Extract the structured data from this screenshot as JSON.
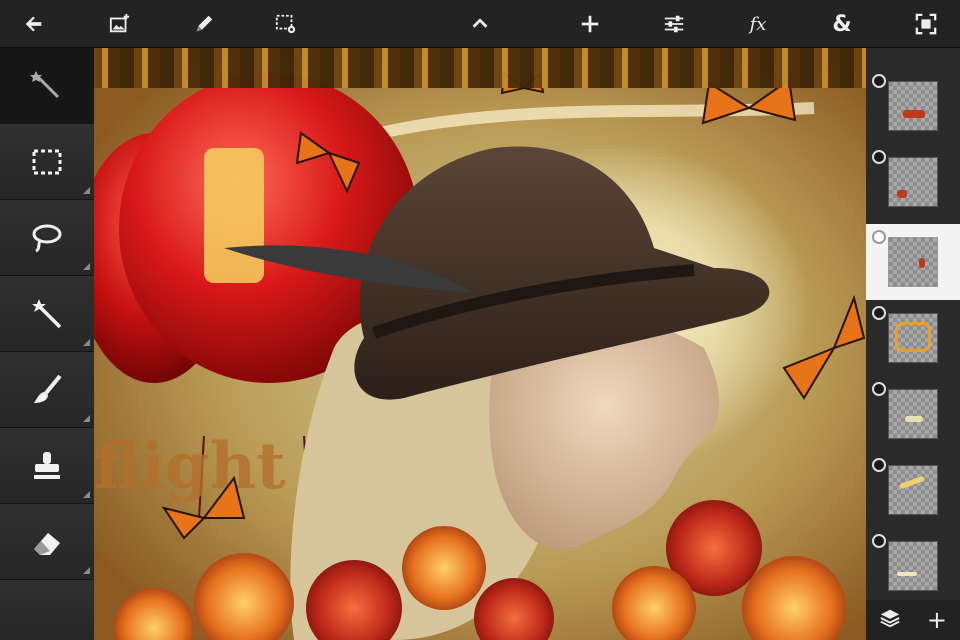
{
  "toolbar": {
    "buttons": [
      {
        "icon": "back-arrow-icon"
      },
      {
        "icon": "add-image-icon"
      },
      {
        "icon": "pencil-icon"
      },
      {
        "icon": "selection-settings-icon"
      },
      {
        "icon": "chevron-up-icon"
      },
      {
        "icon": "plus-icon"
      },
      {
        "icon": "adjustments-icon"
      },
      {
        "icon": "effects-icon",
        "text": "fx"
      },
      {
        "icon": "ampersand-icon",
        "text": "&"
      },
      {
        "icon": "fullscreen-icon"
      }
    ]
  },
  "tools": [
    {
      "icon": "magic-wand-icon",
      "selected": true
    },
    {
      "icon": "rectangle-select-icon"
    },
    {
      "icon": "lasso-icon"
    },
    {
      "icon": "magic-wand-icon"
    },
    {
      "icon": "brush-icon"
    },
    {
      "icon": "stamp-icon"
    },
    {
      "icon": "eraser-icon"
    }
  ],
  "canvas": {
    "artwork_text": "flight"
  },
  "layers": [
    {
      "selected": false,
      "mark_color": "#c0391b"
    },
    {
      "selected": false,
      "mark_color": "#c0391b"
    },
    {
      "selected": true,
      "mark_color": "#b73a1c"
    },
    {
      "selected": false,
      "mark_color": "#e9a030"
    },
    {
      "selected": false,
      "mark_color": "#e8e2b0"
    },
    {
      "selected": false,
      "mark_color": "#f0d070"
    },
    {
      "selected": false,
      "mark_color": "#f0e6c0"
    }
  ],
  "layer_footer": [
    {
      "icon": "layers-icon"
    },
    {
      "icon": "add-layer-icon",
      "text": "+"
    }
  ],
  "colors": {
    "toolbar_bg": "#232323",
    "panel_bg": "#2a2a2a",
    "selected_layer_bg": "#f4f4f4"
  }
}
